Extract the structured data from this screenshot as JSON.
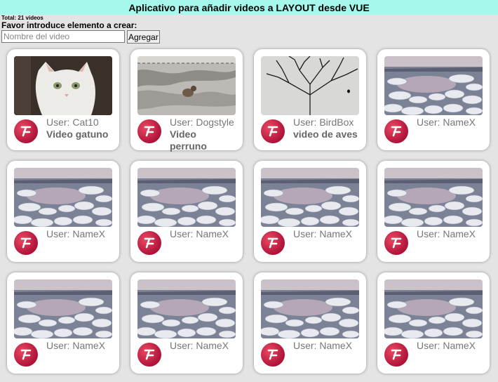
{
  "app": {
    "title": "Aplicativo para añadir videos a LAYOUT desde VUE",
    "total": "Total: 21 videos",
    "prompt": "Favor introduce elemento a crear:",
    "input_placeholder": "Nombre del video",
    "add_label": "Agregar"
  },
  "videos": [
    {
      "user": "User: Cat10",
      "title": "Video gatuno",
      "thumb": "cat"
    },
    {
      "user": "User: Dogstyle",
      "title": "Video perruno",
      "thumb": "dog"
    },
    {
      "user": "User: BirdBox",
      "title": "video de aves",
      "thumb": "bird"
    },
    {
      "user": "User: NameX",
      "title": "",
      "thumb": "ice"
    },
    {
      "user": "User: NameX",
      "title": "",
      "thumb": "ice"
    },
    {
      "user": "User: NameX",
      "title": "",
      "thumb": "ice"
    },
    {
      "user": "User: NameX",
      "title": "",
      "thumb": "ice"
    },
    {
      "user": "User: NameX",
      "title": "",
      "thumb": "ice"
    },
    {
      "user": "User: NameX",
      "title": "",
      "thumb": "ice"
    },
    {
      "user": "User: NameX",
      "title": "",
      "thumb": "ice"
    },
    {
      "user": "User: NameX",
      "title": "",
      "thumb": "ice"
    },
    {
      "user": "User: NameX",
      "title": "",
      "thumb": "ice"
    }
  ]
}
